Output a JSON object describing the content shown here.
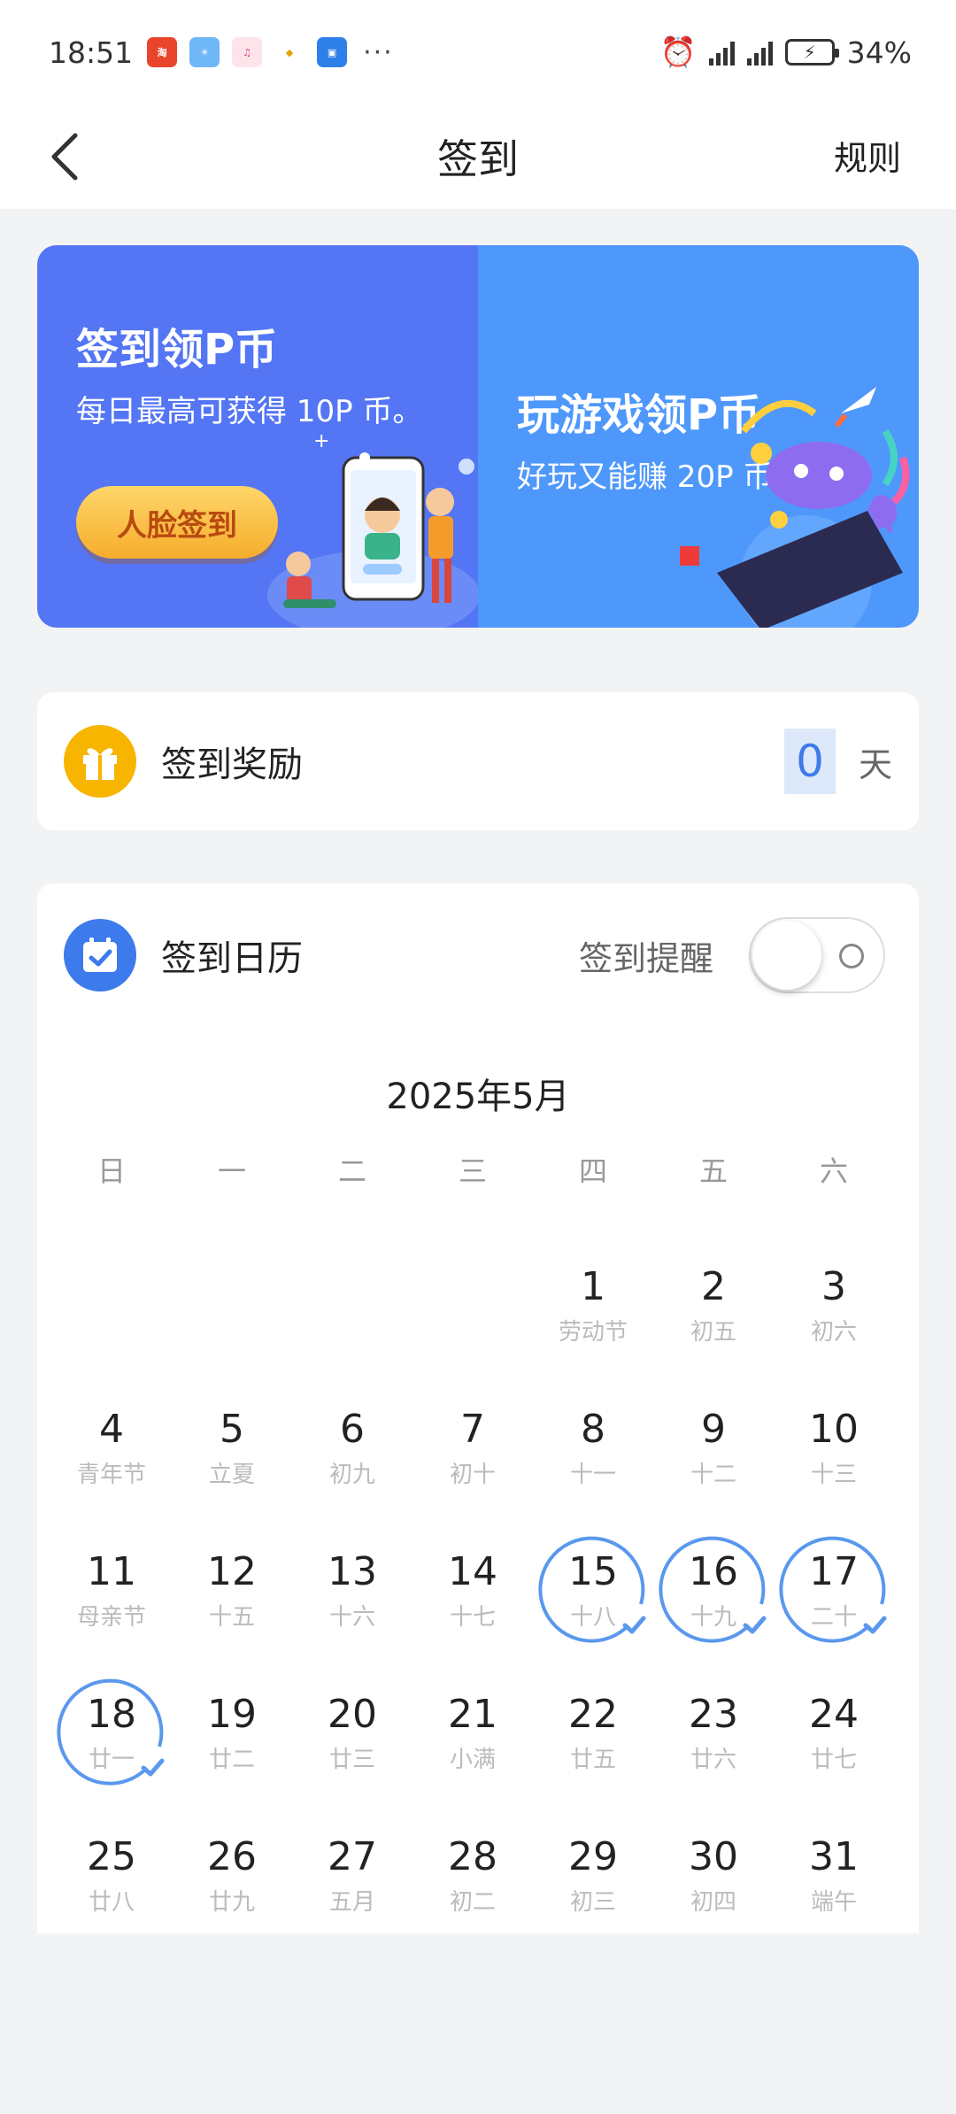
{
  "status_bar": {
    "time": "18:51",
    "battery": "34%",
    "more": "···"
  },
  "nav": {
    "title": "签到",
    "rule": "规则"
  },
  "banner": {
    "left_title": "签到领P币",
    "left_sub": "每日最高可获得 10P 币。",
    "left_button": "人脸签到",
    "right_title": "玩游戏领P币",
    "right_sub": "好玩又能赚 20P 币"
  },
  "reward": {
    "label": "签到奖励",
    "days": "0",
    "unit": "天"
  },
  "calendar": {
    "label": "签到日历",
    "remind_label": "签到提醒",
    "remind_on": false,
    "month": "2025年5月",
    "weekdays": [
      "日",
      "一",
      "二",
      "三",
      "四",
      "五",
      "六"
    ],
    "first_weekday": 4,
    "days": [
      {
        "d": "1",
        "s": "劳动节"
      },
      {
        "d": "2",
        "s": "初五"
      },
      {
        "d": "3",
        "s": "初六"
      },
      {
        "d": "4",
        "s": "青年节"
      },
      {
        "d": "5",
        "s": "立夏"
      },
      {
        "d": "6",
        "s": "初九"
      },
      {
        "d": "7",
        "s": "初十"
      },
      {
        "d": "8",
        "s": "十一"
      },
      {
        "d": "9",
        "s": "十二"
      },
      {
        "d": "10",
        "s": "十三"
      },
      {
        "d": "11",
        "s": "母亲节"
      },
      {
        "d": "12",
        "s": "十五"
      },
      {
        "d": "13",
        "s": "十六"
      },
      {
        "d": "14",
        "s": "十七"
      },
      {
        "d": "15",
        "s": "十八",
        "checked": true
      },
      {
        "d": "16",
        "s": "十九",
        "checked": true
      },
      {
        "d": "17",
        "s": "二十",
        "checked": true
      },
      {
        "d": "18",
        "s": "廿一",
        "checked": true
      },
      {
        "d": "19",
        "s": "廿二"
      },
      {
        "d": "20",
        "s": "廿三"
      },
      {
        "d": "21",
        "s": "小满"
      },
      {
        "d": "22",
        "s": "廿五"
      },
      {
        "d": "23",
        "s": "廿六"
      },
      {
        "d": "24",
        "s": "廿七"
      },
      {
        "d": "25",
        "s": "廿八"
      },
      {
        "d": "26",
        "s": "廿九"
      },
      {
        "d": "27",
        "s": "五月"
      },
      {
        "d": "28",
        "s": "初二"
      },
      {
        "d": "29",
        "s": "初三"
      },
      {
        "d": "30",
        "s": "初四"
      },
      {
        "d": "31",
        "s": "端午"
      }
    ]
  },
  "colors": {
    "accent": "#3d7bec",
    "check_ring": "#5a98ee",
    "banner_left": "#5476f4",
    "banner_right": "#4e98fb",
    "gift": "#f7b500"
  }
}
